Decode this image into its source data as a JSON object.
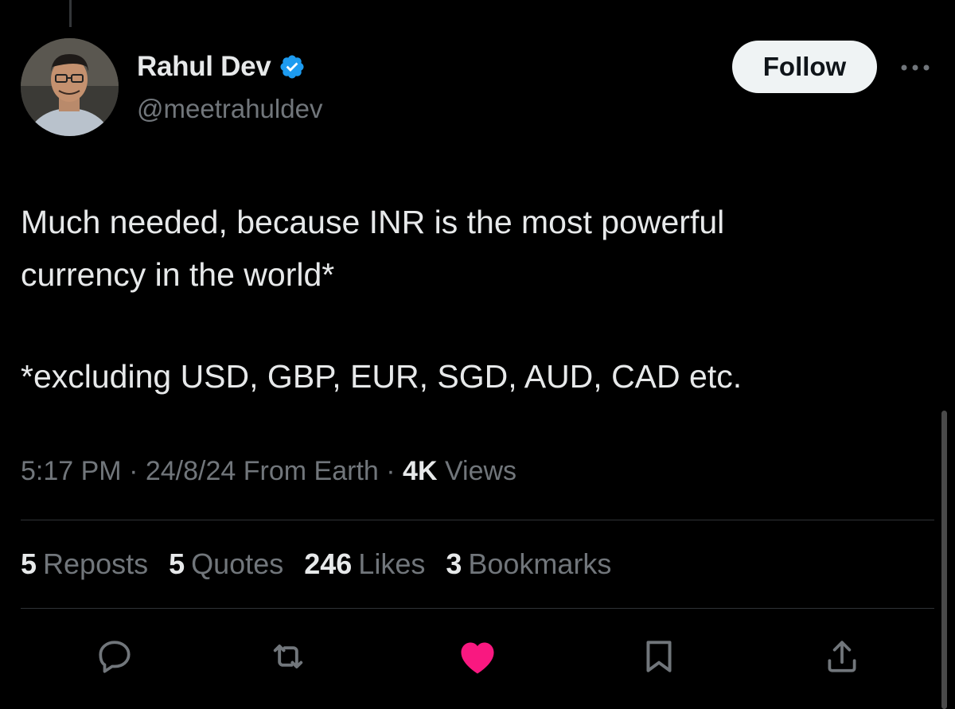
{
  "author": {
    "name": "Rahul Dev",
    "handle": "@meetrahuldev",
    "verified": true
  },
  "header": {
    "follow_label": "Follow",
    "more_icon": "more-horizontal-icon"
  },
  "tweet": {
    "line1": "Much needed, because INR is the most powerful",
    "line2": "currency in the world*",
    "line3": "*excluding USD, GBP, EUR, SGD, AUD, CAD etc."
  },
  "meta": {
    "time": "5:17 PM",
    "sep1": "·",
    "date": "24/8/24",
    "location": "From Earth",
    "sep2": "·",
    "views_count": "4K",
    "views_label": "Views"
  },
  "stats": [
    {
      "count": "5",
      "label": "Reposts"
    },
    {
      "count": "5",
      "label": "Quotes"
    },
    {
      "count": "246",
      "label": "Likes"
    },
    {
      "count": "3",
      "label": "Bookmarks"
    }
  ],
  "actions": {
    "reply_icon": "reply-icon",
    "repost_icon": "repost-icon",
    "like_icon": "heart-icon",
    "bookmark_icon": "bookmark-icon",
    "share_icon": "share-icon"
  },
  "colors": {
    "background": "#000000",
    "text_primary": "#e7e9ea",
    "text_secondary": "#71767b",
    "verified_blue": "#1d9bf0",
    "like_pink": "#f91880",
    "follow_button_bg": "#eff3f4"
  }
}
